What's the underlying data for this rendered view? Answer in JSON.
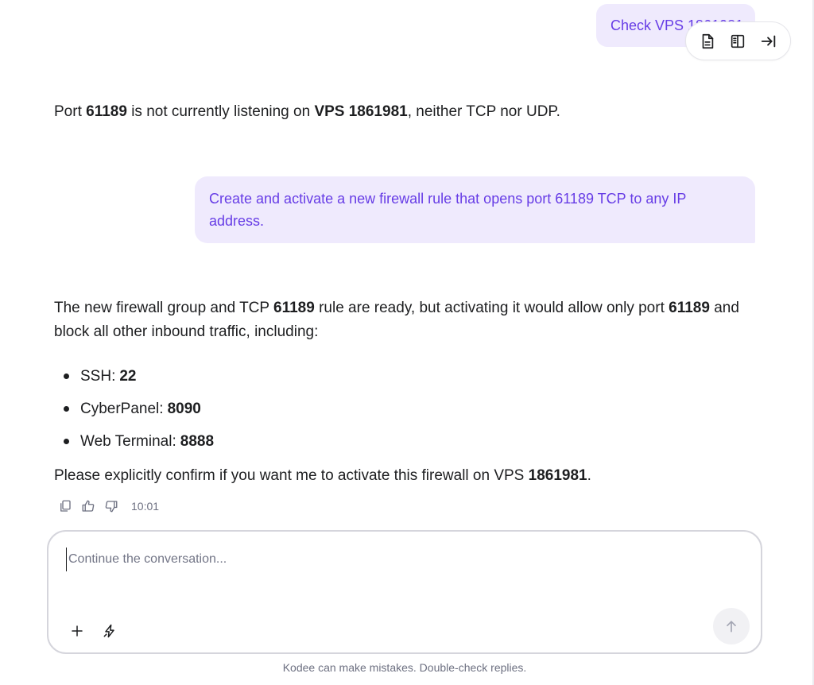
{
  "conversation": {
    "user_msg_1": "Check VPS 1861981",
    "assistant_msg_1": {
      "p1": "Port ",
      "port": "61189",
      "p2": " is not currently listening on ",
      "vps": "VPS 1861981",
      "p3": ", neither TCP nor UDP."
    },
    "user_msg_2": "Create and activate a new firewall rule that opens port 61189 TCP to any IP address.",
    "assistant_msg_2": {
      "p1": "The new firewall group and TCP ",
      "port1": "61189",
      "p2": " rule are ready, but activating it would allow only port ",
      "port2": "61189",
      "p3": " and block all other inbound traffic, including:",
      "bullets": [
        {
          "label": "SSH:",
          "value": "22"
        },
        {
          "label": "CyberPanel:",
          "value": "8090"
        },
        {
          "label": "Web Terminal:",
          "value": "8888"
        }
      ],
      "c1": "Please explicitly confirm if you want me to activate this firewall on VPS ",
      "vps": "1861981",
      "c2": "."
    },
    "timestamp": "10:01"
  },
  "toolbar": {
    "icons": [
      "document-icon",
      "split-view-icon",
      "collapse-right-icon"
    ]
  },
  "composer": {
    "placeholder": "Continue the conversation...",
    "value": ""
  },
  "footer": {
    "disclaimer": "Kodee can make mistakes. Double-check replies."
  },
  "colors": {
    "accent": "#673de6",
    "bubble_bg": "#efeafd",
    "text": "#1d1e20",
    "muted": "#6d7081"
  }
}
